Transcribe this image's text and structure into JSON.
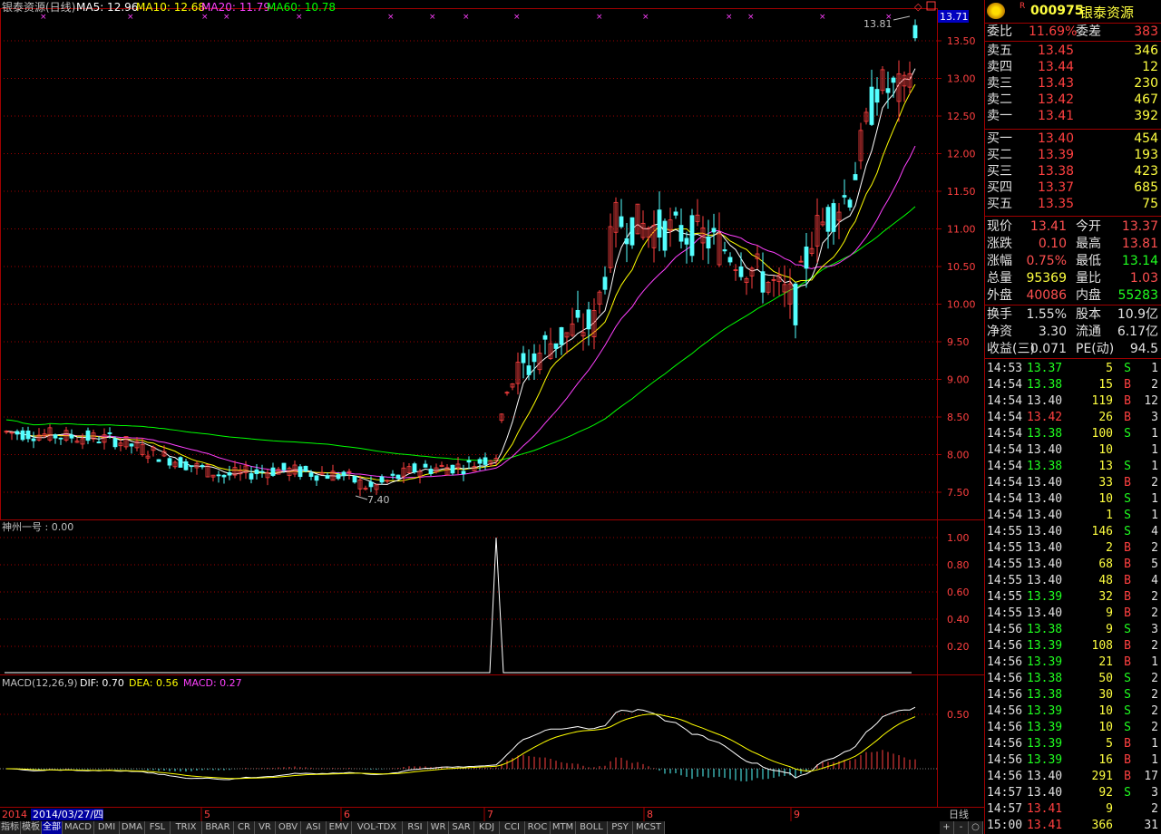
{
  "main": {
    "title": "银泰资源(日线)",
    "ma5": "MA5: 12.96",
    "ma10": "MA10: 12.68",
    "ma20": "MA20: 11.79",
    "ma60": "MA60: 10.78",
    "high_marker": "13.81",
    "low_marker": "7.40",
    "current_price_box": "13.71",
    "y_ticks": [
      "13.50",
      "13.00",
      "12.50",
      "12.00",
      "11.50",
      "11.00",
      "10.50",
      "10.00",
      "9.50",
      "9.00",
      "8.50",
      "8.00",
      "7.50"
    ]
  },
  "indicator1": {
    "title": "神州一号 : 0.00",
    "y_ticks": [
      "1.00",
      "0.80",
      "0.60",
      "0.40",
      "0.20"
    ]
  },
  "macd": {
    "label": "MACD(12,26,9)",
    "dif": "DIF: 0.70",
    "dea": "DEA: 0.56",
    "macd": "MACD: 0.27",
    "y_ticks": [
      "0.50"
    ]
  },
  "x_axis": {
    "start_label": "2014",
    "cursor_date": "2014/03/27/四",
    "months": [
      "5",
      "6",
      "7",
      "8",
      "9"
    ],
    "period": "日线"
  },
  "tabs": [
    "指标",
    "模板",
    "全部",
    "MACD",
    "DMI",
    "DMA",
    "FSL",
    "TRIX",
    "BRAR",
    "CR",
    "VR",
    "OBV",
    "ASI",
    "EMV",
    "VOL-TDX",
    "RSI",
    "WR",
    "SAR",
    "KDJ",
    "CCI",
    "ROC",
    "MTM",
    "BOLL",
    "PSY",
    "MCST"
  ],
  "tab_controls": [
    "+",
    "-",
    "○"
  ],
  "side": {
    "badge": "R",
    "code": "000975",
    "name": "银泰资源",
    "weibi_label": "委比",
    "weibi_value": "11.69%",
    "weicha_label": "委差",
    "weicha_value": "383",
    "asks": [
      {
        "label": "卖五",
        "price": "13.45",
        "vol": "346"
      },
      {
        "label": "卖四",
        "price": "13.44",
        "vol": "12"
      },
      {
        "label": "卖三",
        "price": "13.43",
        "vol": "230"
      },
      {
        "label": "卖二",
        "price": "13.42",
        "vol": "467"
      },
      {
        "label": "卖一",
        "price": "13.41",
        "vol": "392"
      }
    ],
    "bids": [
      {
        "label": "买一",
        "price": "13.40",
        "vol": "454"
      },
      {
        "label": "买二",
        "price": "13.39",
        "vol": "193"
      },
      {
        "label": "买三",
        "price": "13.38",
        "vol": "423"
      },
      {
        "label": "买四",
        "price": "13.37",
        "vol": "685"
      },
      {
        "label": "买五",
        "price": "13.35",
        "vol": "75"
      }
    ],
    "quotes": [
      {
        "l1": "现价",
        "v1": "13.41",
        "l2": "今开",
        "v2": "13.37",
        "c1": "#ff5050",
        "c2": "#ff5050"
      },
      {
        "l1": "涨跌",
        "v1": "0.10",
        "l2": "最高",
        "v2": "13.81",
        "c1": "#ff5050",
        "c2": "#ff5050"
      },
      {
        "l1": "涨幅",
        "v1": "0.75%",
        "l2": "最低",
        "v2": "13.14",
        "c1": "#ff5050",
        "c2": "#20ff20"
      },
      {
        "l1": "总量",
        "v1": "95369",
        "l2": "量比",
        "v2": "1.03",
        "c1": "#ffff40",
        "c2": "#ff5050"
      },
      {
        "l1": "外盘",
        "v1": "40086",
        "l2": "内盘",
        "v2": "55283",
        "c1": "#ff5050",
        "c2": "#20ff20"
      }
    ],
    "fundamentals": [
      {
        "l1": "换手",
        "v1": "1.55%",
        "l2": "股本",
        "v2": "10.9亿"
      },
      {
        "l1": "净资",
        "v1": "3.30",
        "l2": "流通",
        "v2": "6.17亿"
      },
      {
        "l1": "收益(三)",
        "v1": "0.071",
        "l2": "PE(动)",
        "v2": "94.5"
      }
    ],
    "ticks": [
      {
        "t": "14:53",
        "p": "13.37",
        "v": "5",
        "d": "S",
        "n": "1"
      },
      {
        "t": "14:54",
        "p": "13.38",
        "v": "15",
        "d": "B",
        "n": "2"
      },
      {
        "t": "14:54",
        "p": "13.40",
        "v": "119",
        "d": "B",
        "n": "12"
      },
      {
        "t": "14:54",
        "p": "13.42",
        "v": "26",
        "d": "B",
        "n": "3"
      },
      {
        "t": "14:54",
        "p": "13.38",
        "v": "100",
        "d": "S",
        "n": "1"
      },
      {
        "t": "14:54",
        "p": "13.40",
        "v": "10",
        "d": "",
        "n": "1"
      },
      {
        "t": "14:54",
        "p": "13.38",
        "v": "13",
        "d": "S",
        "n": "1"
      },
      {
        "t": "14:54",
        "p": "13.40",
        "v": "33",
        "d": "B",
        "n": "2"
      },
      {
        "t": "14:54",
        "p": "13.40",
        "v": "10",
        "d": "S",
        "n": "1"
      },
      {
        "t": "14:54",
        "p": "13.40",
        "v": "1",
        "d": "S",
        "n": "1"
      },
      {
        "t": "14:55",
        "p": "13.40",
        "v": "146",
        "d": "S",
        "n": "4"
      },
      {
        "t": "14:55",
        "p": "13.40",
        "v": "2",
        "d": "B",
        "n": "2"
      },
      {
        "t": "14:55",
        "p": "13.40",
        "v": "68",
        "d": "B",
        "n": "5"
      },
      {
        "t": "14:55",
        "p": "13.40",
        "v": "48",
        "d": "B",
        "n": "4"
      },
      {
        "t": "14:55",
        "p": "13.39",
        "v": "32",
        "d": "B",
        "n": "2"
      },
      {
        "t": "14:55",
        "p": "13.40",
        "v": "9",
        "d": "B",
        "n": "2"
      },
      {
        "t": "14:56",
        "p": "13.38",
        "v": "9",
        "d": "S",
        "n": "3"
      },
      {
        "t": "14:56",
        "p": "13.39",
        "v": "108",
        "d": "B",
        "n": "2"
      },
      {
        "t": "14:56",
        "p": "13.39",
        "v": "21",
        "d": "B",
        "n": "1"
      },
      {
        "t": "14:56",
        "p": "13.38",
        "v": "50",
        "d": "S",
        "n": "2"
      },
      {
        "t": "14:56",
        "p": "13.38",
        "v": "30",
        "d": "S",
        "n": "2"
      },
      {
        "t": "14:56",
        "p": "13.39",
        "v": "10",
        "d": "S",
        "n": "2"
      },
      {
        "t": "14:56",
        "p": "13.39",
        "v": "10",
        "d": "S",
        "n": "2"
      },
      {
        "t": "14:56",
        "p": "13.39",
        "v": "5",
        "d": "B",
        "n": "1"
      },
      {
        "t": "14:56",
        "p": "13.39",
        "v": "16",
        "d": "B",
        "n": "1"
      },
      {
        "t": "14:56",
        "p": "13.40",
        "v": "291",
        "d": "B",
        "n": "17"
      },
      {
        "t": "14:57",
        "p": "13.40",
        "v": "92",
        "d": "S",
        "n": "3"
      },
      {
        "t": "14:57",
        "p": "13.41",
        "v": "9",
        "d": "",
        "n": "2"
      },
      {
        "t": "15:00",
        "p": "13.41",
        "v": "366",
        "d": "",
        "n": "31"
      }
    ]
  },
  "colors": {
    "up": "#ff4040",
    "down": "#54ffff",
    "ma5": "#ffffff",
    "ma10": "#ffff00",
    "ma20": "#ff40ff",
    "ma60": "#00ff00",
    "grid": "#a00000"
  }
}
